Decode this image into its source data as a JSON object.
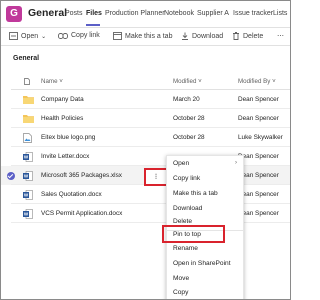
{
  "header": {
    "team_initial": "G",
    "channel": "General",
    "tabs": [
      "Posts",
      "Files",
      "Production Planner",
      "Notebook",
      "Supplier A",
      "Issue tracker",
      "Lists"
    ],
    "active_tab": "Files"
  },
  "toolbar": {
    "open": "Open",
    "copy_link": "Copy link",
    "make_tab": "Make this a tab",
    "download": "Download",
    "delete": "Delete"
  },
  "section_title": "General",
  "columns": {
    "name": "Name",
    "modified": "Modified",
    "modified_by": "Modified By"
  },
  "files": [
    {
      "name": "Company Data",
      "modified": "March 20",
      "by": "Dean Spencer",
      "type": "folder"
    },
    {
      "name": "Health Policies",
      "modified": "October 28",
      "by": "Dean Spencer",
      "type": "folder"
    },
    {
      "name": "Eitex blue logo.png",
      "modified": "October 28",
      "by": "Luke Skywalker",
      "type": "image"
    },
    {
      "name": "Invite Letter.docx",
      "modified": "",
      "by": "Dean Spencer",
      "type": "word"
    },
    {
      "name": "Microsoft 365 Packages.xlsx",
      "modified": "",
      "by": "Dean Spencer",
      "type": "word"
    },
    {
      "name": "Sales Quotation.docx",
      "modified": "",
      "by": "Dean Spencer",
      "type": "word"
    },
    {
      "name": "VCS Permit Application.docx",
      "modified": "",
      "by": "Dean Spencer",
      "type": "word"
    }
  ],
  "more_options": "⁝",
  "menu": [
    "Open",
    "Copy link",
    "Make this a tab",
    "Download",
    "Delete",
    "Pin to top",
    "Rename",
    "Open in SharePoint",
    "Move",
    "Copy"
  ],
  "colors": {
    "accent": "#5b5fc7",
    "highlight": "#d9232d",
    "folder": "#f4c55a",
    "word": "#2b579a"
  }
}
